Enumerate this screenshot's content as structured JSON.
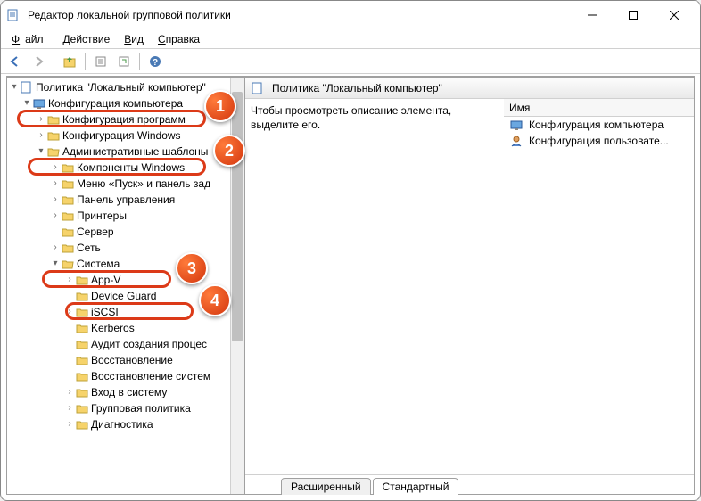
{
  "window": {
    "title": "Редактор локальной групповой политики"
  },
  "menubar": {
    "file": "Файл",
    "action": "Действие",
    "view": "Вид",
    "help": "Справка"
  },
  "tree": {
    "root": "Политика \"Локальный компьютер\"",
    "comp_config": "Конфигурация компьютера",
    "prog_config": "Конфигурация программ",
    "win_config": "Конфигурация Windows",
    "admin_tpl": "Административные шаблоны",
    "comp_win": "Компоненты Windows",
    "start_panel": "Меню «Пуск» и панель зад",
    "ctrl_panel": "Панель управления",
    "printers": "Принтеры",
    "server": "Сервер",
    "network": "Сеть",
    "system": "Система",
    "appv": "App-V",
    "device_guard": "Device Guard",
    "iscsi": "iSCSI",
    "kerberos": "Kerberos",
    "audit": "Аудит создания процес",
    "recovery": "Восстановление",
    "sys_recovery": "Восстановление систем",
    "logon": "Вход в систему",
    "group_policy": "Групповая политика",
    "diagnostics": "Диагностика"
  },
  "right": {
    "header": "Политика \"Локальный компьютер\"",
    "desc": "Чтобы просмотреть описание элемента, выделите его.",
    "col": "Имя",
    "item1": "Конфигурация компьютера",
    "item2": "Конфигурация пользовате..."
  },
  "tabs": {
    "extended": "Расширенный",
    "standard": "Стандартный"
  },
  "badges": {
    "b1": "1",
    "b2": "2",
    "b3": "3",
    "b4": "4"
  }
}
